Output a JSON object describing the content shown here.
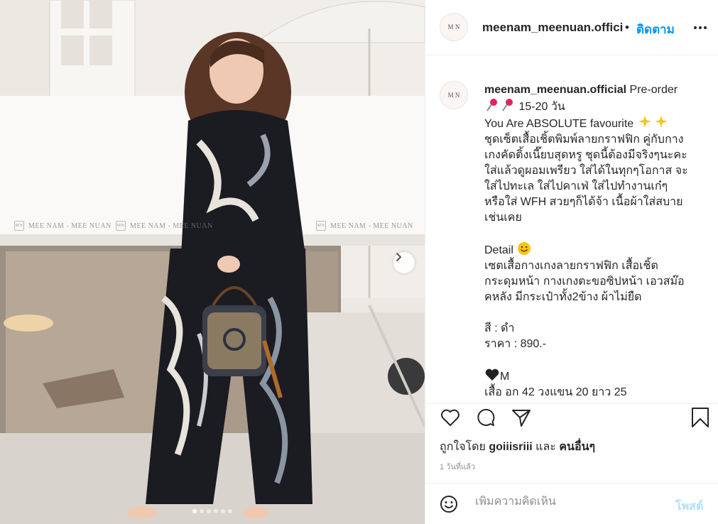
{
  "post": {
    "username": "meenam_meenuan.official",
    "header_username": "meenam_meenuan.officia",
    "follow_dot": "•",
    "follow_label": "ติดตาม",
    "avatar_monogram": "M N",
    "caption_lines": [
      "Pre-order",
      "15-20 วัน",
      "You Are ABSOLUTE favourite",
      "ชุดเซ็ตเสื้อเชิ้ตพิมพ์ลายกราฟฟิก คู่กับกาง",
      "เกงคัดติ้งเนี๊ยบสุดหรู ชุดนี้ต้องมีจริงๆนะคะ",
      "ใส่แล้วดูผอมเพรียว ใส่ได้ในทุกๆโอกาส จะ",
      "ใส่ไปทะเล ใส่ไปคาเฟ่ ใส่ไปทำงานเก๋ๆ",
      "หรือใส่ WFH สวยๆก็ได้จ้า เนื้อผ้าใส่สบาย",
      "เช่นเคย",
      "Detail",
      "เซตเสื้อกางเกงลายกราฟฟิก เสื้อเชิ้ต",
      "กระดุมหน้า กางเกงตะขอซิปหน้า เอวสม๊อ",
      "คหลัง มีกระเป๋าทั้ง2ข้าง ผ้าไม่ยืด",
      "สี : ดำ",
      "ราคา : 890.-",
      "M",
      "เสื้อ อก 42 วงแขน 20 ยาว 25"
    ],
    "likes_prefix": "ถูกใจโดย",
    "likes_user": "goiiisriii",
    "likes_and": "และ",
    "likes_others": "คนอื่นๆ",
    "time_ago": "1 วันที่แล้ว",
    "comment_placeholder": "เพิ่มความคิดเห็น",
    "post_label": "โพสต์",
    "watermark_text": "MEE NAM - MEE NUAN",
    "carousel": {
      "count": 6,
      "active": 0
    }
  },
  "colors": {
    "link_blue": "#0095f6",
    "post_disabled": "#b2dffc",
    "muted": "#8e8e8e",
    "text": "#262626"
  },
  "icons": [
    "heart-icon",
    "comment-icon",
    "share-icon",
    "bookmark-icon",
    "more-icon",
    "emoji-icon",
    "chevron-right-icon",
    "pin-emoji",
    "sparkle-emoji",
    "smile-emoji",
    "black-heart-emoji"
  ]
}
